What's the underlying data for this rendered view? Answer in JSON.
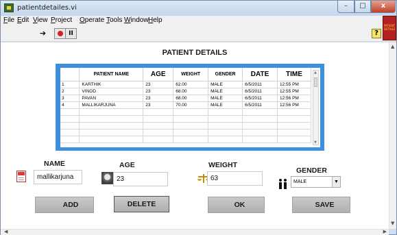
{
  "window": {
    "title": "patientdetailes.vi",
    "controls": {
      "minimize": "–",
      "maximize": "□",
      "close": "x"
    }
  },
  "menubar": {
    "items": [
      {
        "label": "File",
        "u": "F",
        "rest": "ile"
      },
      {
        "label": "Edit",
        "u": "E",
        "rest": "dit"
      },
      {
        "label": "View",
        "u": "V",
        "rest": "iew"
      },
      {
        "label": "Project",
        "u": "P",
        "rest": "roject"
      },
      {
        "label": "Operate",
        "u": "O",
        "rest": "perate"
      },
      {
        "label": "Tools",
        "u": "T",
        "rest": "ools"
      },
      {
        "label": "Window",
        "u": "W",
        "rest": "indow"
      },
      {
        "label": "Help",
        "u": "H",
        "rest": "elp"
      }
    ]
  },
  "toolbar": {
    "run_glyph": "➔",
    "pause_glyph": "II",
    "help_glyph": "?"
  },
  "vi_icon_text": "PATIENT DETAILS",
  "panel": {
    "heading": "PATIENT DETAILS"
  },
  "table": {
    "columns": [
      "",
      "PATIENT NAME",
      "AGE",
      "WEIGHT",
      "GENDER",
      "DATE",
      "TIME"
    ],
    "rows": [
      [
        "1",
        "KARTHIK",
        "23",
        "62.00",
        "MALE",
        "6/5/2011",
        "12:55 PM"
      ],
      [
        "2",
        "VINOD",
        "23",
        "68.00",
        "MALE",
        "6/5/2011",
        "12:55 PM"
      ],
      [
        "3",
        "PAVAN",
        "23",
        "68.00",
        "MALE",
        "6/5/2011",
        "12:56 PM"
      ],
      [
        "4",
        "MALLIKARJUNA",
        "23",
        "70.00",
        "MALE",
        "6/5/2011",
        "12:56 PM"
      ],
      [
        "",
        "",
        "",
        "",
        "",
        "",
        ""
      ],
      [
        "",
        "",
        "",
        "",
        "",
        "",
        ""
      ],
      [
        "",
        "",
        "",
        "",
        "",
        "",
        ""
      ],
      [
        "",
        "",
        "",
        "",
        "",
        "",
        ""
      ],
      [
        "",
        "",
        "",
        "",
        "",
        "",
        ""
      ]
    ]
  },
  "form": {
    "name_label": "NAME",
    "name_value": "mallikarjuna",
    "age_label": "AGE",
    "age_value": "23",
    "weight_label": "WEIGHT",
    "weight_value": "63",
    "gender_label": "GENDER",
    "gender_value": "MALE"
  },
  "buttons": {
    "add": "ADD",
    "delete": "DELETE",
    "ok": "OK",
    "save": "SAVE"
  },
  "colors": {
    "table_frame": "#3d8fe0",
    "button_face": "#c0c0c0",
    "close_button": "#c0402a"
  }
}
